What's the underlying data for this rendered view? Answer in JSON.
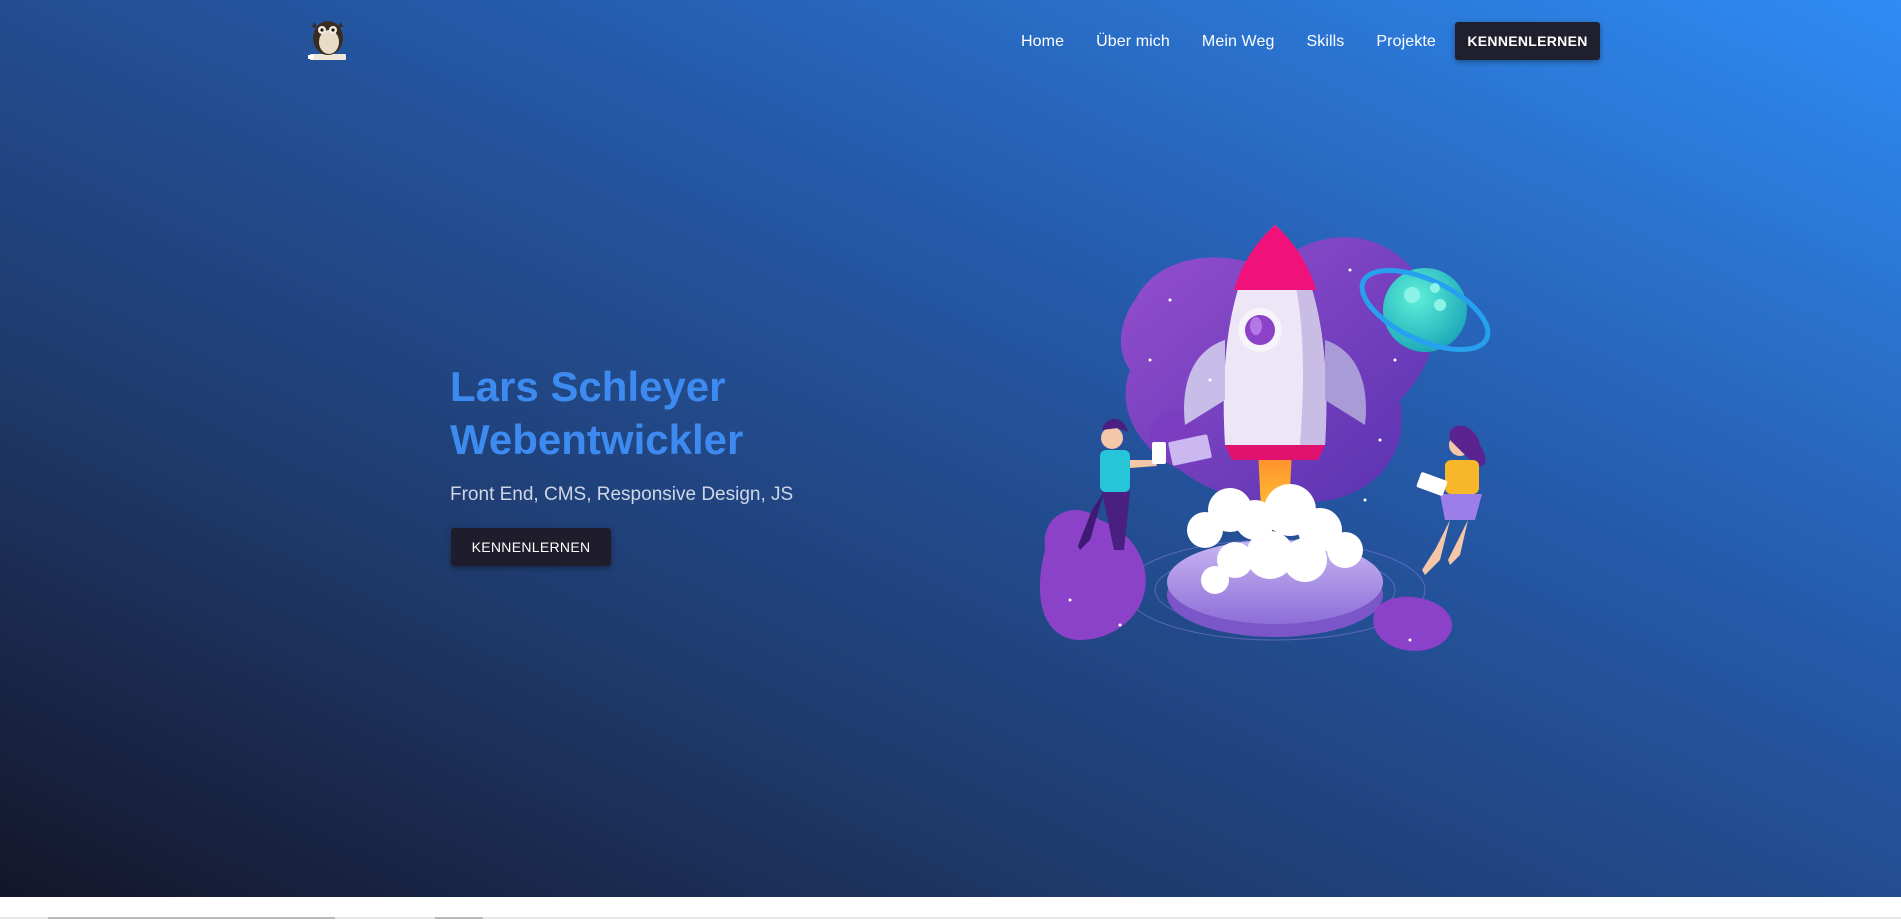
{
  "header": {
    "logo_icon": "owl-mascot-logo",
    "nav": [
      "Home",
      "Über mich",
      "Mein Weg",
      "Skills",
      "Projekte"
    ],
    "cta_label": "KENNENLERNEN"
  },
  "hero": {
    "title_line1": "Lars Schleyer",
    "title_line2": "Webentwickler",
    "subtitle": "Front End, CMS, Responsive Design, JS",
    "cta_label": "KENNENLERNEN",
    "illustration": "rocket-launch-illustration"
  },
  "colors": {
    "gradient_dark": "#14162a",
    "gradient_light": "#2f8cf4",
    "title_blue": "#3d8bf0",
    "button_dark": "#1f1f2e",
    "rocket_pink": "#f0127a",
    "blob_purple": "#8a3fc6",
    "planet_teal": "#28d0c8"
  }
}
